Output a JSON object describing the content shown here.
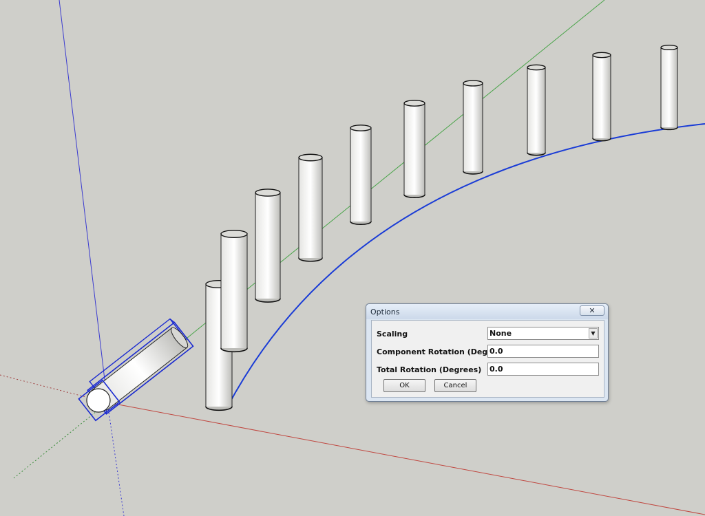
{
  "scene": {
    "background_color": "#cfcfca",
    "axis_colors": {
      "red": "#c0463f",
      "green": "#47a347",
      "blue": "#3a3ad0"
    },
    "path_color": "#1a3cd6",
    "selection_color": "#1a2ad0",
    "cylinder_count": 11
  },
  "dialog": {
    "title": "Options",
    "close_symbol": "✕",
    "fields": [
      {
        "label": "Scaling",
        "value": "None",
        "type": "dropdown"
      },
      {
        "label": "Component Rotation (Degrees)",
        "value": "0.0",
        "type": "text"
      },
      {
        "label": "Total Rotation (Degrees)",
        "value": "0.0",
        "type": "text"
      }
    ],
    "buttons": {
      "ok": "OK",
      "cancel": "Cancel"
    }
  }
}
